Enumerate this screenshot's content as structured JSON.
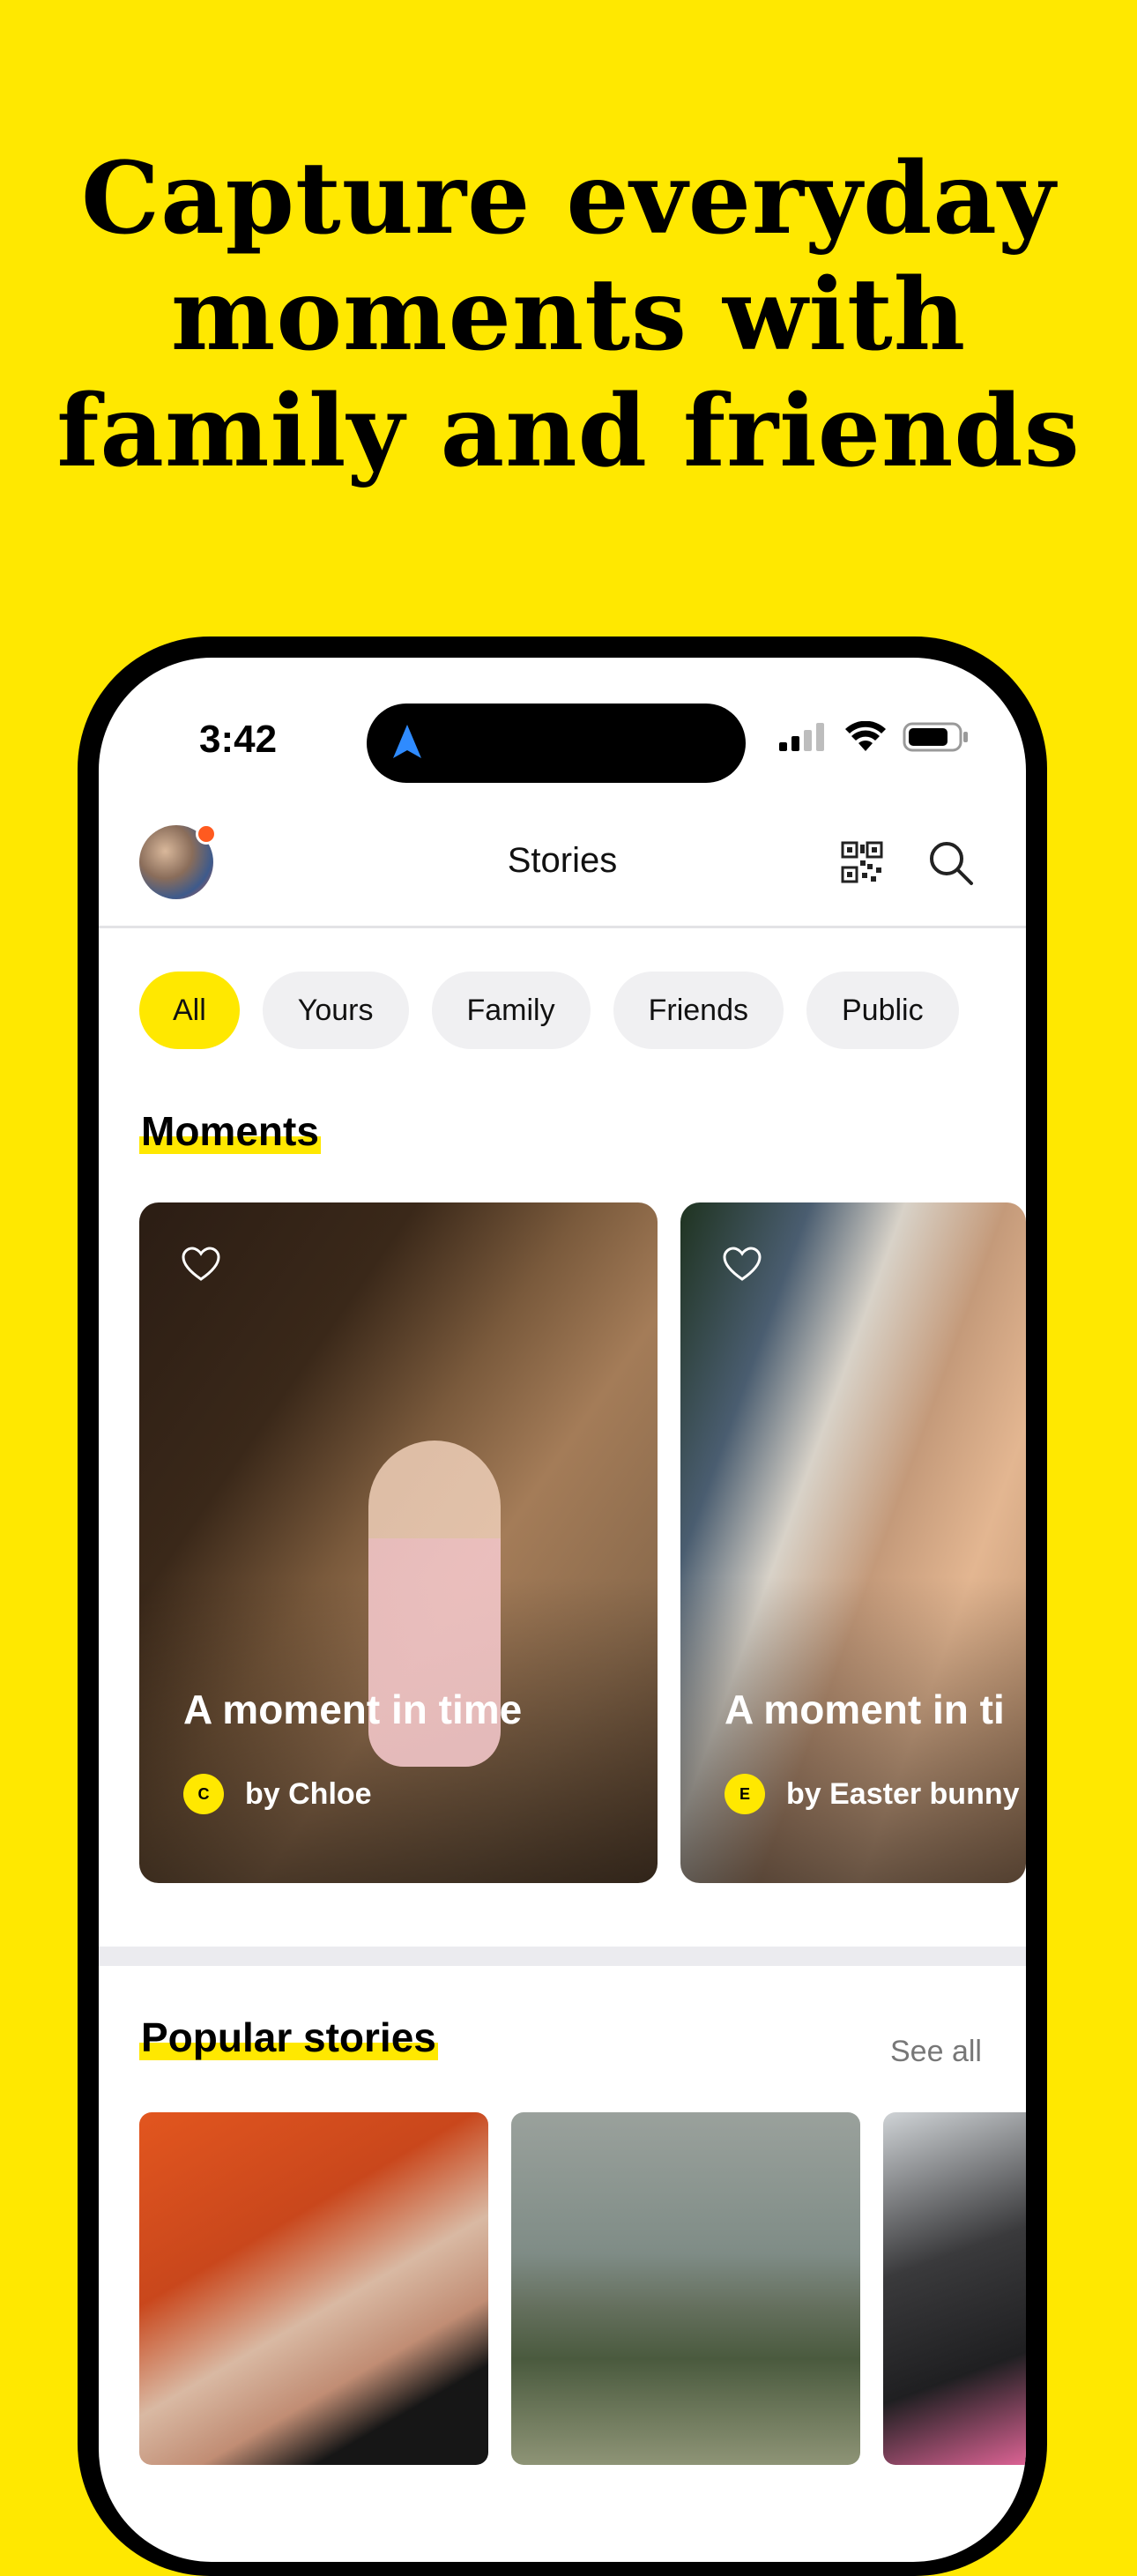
{
  "headline": {
    "line1": "Capture everyday",
    "line2": "moments with",
    "line3": "family and friends"
  },
  "status_bar": {
    "time": "3:42"
  },
  "app_bar": {
    "title": "Stories"
  },
  "filters": [
    {
      "label": "All",
      "selected": true
    },
    {
      "label": "Yours",
      "selected": false
    },
    {
      "label": "Family",
      "selected": false
    },
    {
      "label": "Friends",
      "selected": false
    },
    {
      "label": "Public",
      "selected": false
    }
  ],
  "moments": {
    "title": "Moments",
    "cards": [
      {
        "title": "A moment in time",
        "author_initial": "C",
        "author": "by Chloe"
      },
      {
        "title": "A moment in ti",
        "author_initial": "E",
        "author": "by Easter bunny"
      }
    ]
  },
  "popular": {
    "title": "Popular stories",
    "see_all": "See all"
  },
  "colors": {
    "brand_yellow": "#FFE800",
    "notification_dot": "#FF5A1F"
  },
  "icons": [
    "navigation-arrow-icon",
    "signal-icon",
    "wifi-icon",
    "battery-icon",
    "qr-code-icon",
    "search-icon",
    "heart-icon"
  ]
}
